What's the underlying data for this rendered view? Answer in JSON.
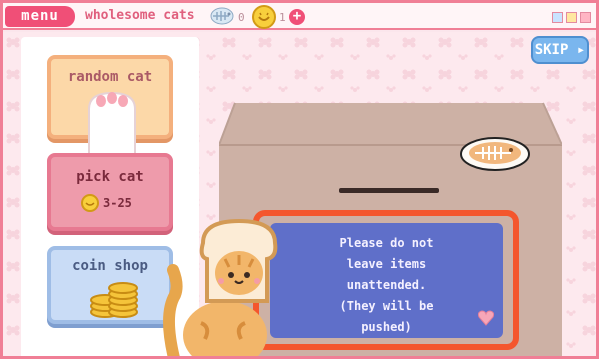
{
  "titlebar": {
    "menu_label": "menu",
    "title": "wholesome cats",
    "fish_count": "0",
    "coin_count": "1",
    "plus_label": "+"
  },
  "cards": {
    "random": {
      "label": "random cat"
    },
    "pick": {
      "label": "pick cat",
      "price": "3-25"
    },
    "shop": {
      "label": "coin shop"
    }
  },
  "skip": {
    "label": "SKIP ▸"
  },
  "sign": {
    "line1": "Please do not",
    "line2": "leave items",
    "line3": "unattended.",
    "line4": "(They will be",
    "line5": "pushed)"
  },
  "colors": {
    "accent": "#f04f77",
    "sign_bg": "#5f6fc9",
    "box": "#cdb1a5"
  }
}
